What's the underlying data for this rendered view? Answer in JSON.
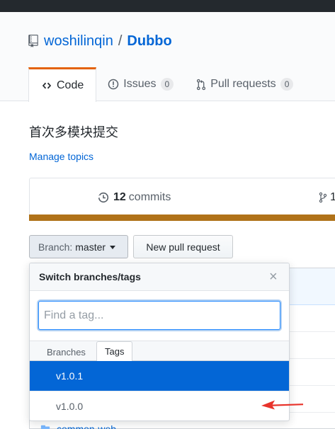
{
  "repo": {
    "owner": "woshilinqin",
    "separator": "/",
    "name": "Dubbo"
  },
  "tabs": [
    {
      "label": "Code"
    },
    {
      "label": "Issues",
      "count": "0"
    },
    {
      "label": "Pull requests",
      "count": "0"
    }
  ],
  "description": "首次多模块提交",
  "topics_link": "Manage topics",
  "summary": {
    "commits_count": "12",
    "commits_label": "commits",
    "branches_count": "1"
  },
  "branch_button": {
    "label": "Branch:",
    "value": "master"
  },
  "new_pr_button": "New pull request",
  "dropdown": {
    "title": "Switch branches/tags",
    "close": "×",
    "filter_placeholder": "Find a tag...",
    "tabs": [
      "Branches",
      "Tags"
    ],
    "items": [
      "v1.0.1",
      "v1.0.0"
    ]
  },
  "background_file": "common-web",
  "colors": {
    "accent": "#0366d6",
    "tab_active_border": "#e36209",
    "language_bar": "#b07219",
    "arrow": "#e8332b"
  }
}
